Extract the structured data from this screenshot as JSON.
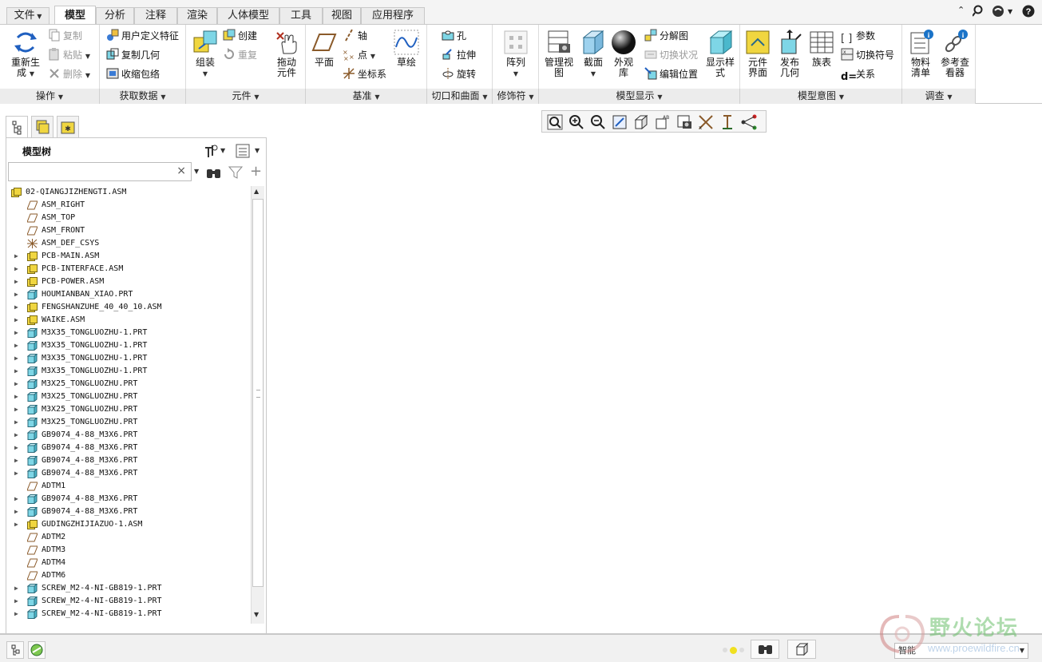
{
  "tabs": [
    "文件",
    "模型",
    "分析",
    "注释",
    "渲染",
    "人体模型",
    "工具",
    "视图",
    "应用程序"
  ],
  "ribbon": {
    "operations": {
      "regen": "重新生成",
      "copy": "复制",
      "paste": "粘贴",
      "delete": "删除",
      "label": "操作"
    },
    "getdata": {
      "udf": "用户定义特征",
      "copygeom": "复制几何",
      "shrinkwrap": "收缩包络",
      "label": "获取数据"
    },
    "component": {
      "assemble": "组装",
      "create": "创建",
      "repeat": "重复",
      "drag": "拖动元件",
      "label": "元件"
    },
    "datum": {
      "plane": "平面",
      "axis": "轴",
      "point": "点",
      "csys": "坐标系",
      "sketch": "草绘",
      "label": "基准"
    },
    "cut": {
      "hole": "孔",
      "extrude": "拉伸",
      "revolve": "旋转",
      "label": "切口和曲面"
    },
    "modifiers": {
      "pattern": "阵列",
      "label": "修饰符"
    },
    "display": {
      "manageview": "管理视图",
      "section": "截面",
      "appearance": "外观库",
      "explode": "分解图",
      "toggle": "切换状况",
      "editpos": "编辑位置",
      "dispstyle": "显示样式",
      "label": "模型显示"
    },
    "intent": {
      "compinterface": "元件界面",
      "pubgeom": "发布几何",
      "family": "族表",
      "params": "参数",
      "switchsym": "切换符号",
      "relations": "关系",
      "label": "模型意图"
    },
    "investigate": {
      "bom": "物料清单",
      "refviewer": "参考查看器",
      "label": "调查"
    }
  },
  "panel": {
    "title": "模型树",
    "search_placeholder": ""
  },
  "tree": [
    {
      "label": "02-QIANGJIZHENGTI.ASM",
      "type": "asm",
      "expandable": false,
      "root": true
    },
    {
      "label": "ASM_RIGHT",
      "type": "datum",
      "expandable": false
    },
    {
      "label": "ASM_TOP",
      "type": "datum",
      "expandable": false
    },
    {
      "label": "ASM_FRONT",
      "type": "datum",
      "expandable": false
    },
    {
      "label": "ASM_DEF_CSYS",
      "type": "csys",
      "expandable": false
    },
    {
      "label": "PCB-MAIN.ASM",
      "type": "asm",
      "expandable": true
    },
    {
      "label": "PCB-INTERFACE.ASM",
      "type": "asm",
      "expandable": true
    },
    {
      "label": "PCB-POWER.ASM",
      "type": "asm",
      "expandable": true
    },
    {
      "label": "HOUMIANBAN_XIAO.PRT",
      "type": "prt",
      "expandable": true
    },
    {
      "label": "FENGSHANZUHE_40_40_10.ASM",
      "type": "asm",
      "expandable": true
    },
    {
      "label": "WAIKE.ASM",
      "type": "asm",
      "expandable": true
    },
    {
      "label": "M3X35_TONGLUOZHU-1.PRT",
      "type": "prt",
      "expandable": true
    },
    {
      "label": "M3X35_TONGLUOZHU-1.PRT",
      "type": "prt",
      "expandable": true
    },
    {
      "label": "M3X35_TONGLUOZHU-1.PRT",
      "type": "prt",
      "expandable": true
    },
    {
      "label": "M3X35_TONGLUOZHU-1.PRT",
      "type": "prt",
      "expandable": true
    },
    {
      "label": "M3X25_TONGLUOZHU.PRT",
      "type": "prt",
      "expandable": true
    },
    {
      "label": "M3X25_TONGLUOZHU.PRT",
      "type": "prt",
      "expandable": true
    },
    {
      "label": "M3X25_TONGLUOZHU.PRT",
      "type": "prt",
      "expandable": true
    },
    {
      "label": "M3X25_TONGLUOZHU.PRT",
      "type": "prt",
      "expandable": true
    },
    {
      "label": "GB9074_4-88_M3X6.PRT",
      "type": "prt",
      "expandable": true
    },
    {
      "label": "GB9074_4-88_M3X6.PRT",
      "type": "prt",
      "expandable": true
    },
    {
      "label": "GB9074_4-88_M3X6.PRT",
      "type": "prt",
      "expandable": true
    },
    {
      "label": "GB9074_4-88_M3X6.PRT",
      "type": "prt",
      "expandable": true
    },
    {
      "label": "ADTM1",
      "type": "datum",
      "expandable": false
    },
    {
      "label": "GB9074_4-88_M3X6.PRT",
      "type": "prt",
      "expandable": true
    },
    {
      "label": "GB9074_4-88_M3X6.PRT",
      "type": "prt",
      "expandable": true
    },
    {
      "label": "GUDINGZHIJIAZUO-1.ASM",
      "type": "asm",
      "expandable": true
    },
    {
      "label": "ADTM2",
      "type": "datum",
      "expandable": false
    },
    {
      "label": "ADTM3",
      "type": "datum",
      "expandable": false
    },
    {
      "label": "ADTM4",
      "type": "datum",
      "expandable": false
    },
    {
      "label": "ADTM6",
      "type": "datum",
      "expandable": false
    },
    {
      "label": "SCREW_M2-4-NI-GB819-1.PRT",
      "type": "prt",
      "expandable": true
    },
    {
      "label": "SCREW_M2-4-NI-GB819-1.PRT",
      "type": "prt",
      "expandable": true
    },
    {
      "label": "SCREW_M2-4-NI-GB819-1.PRT",
      "type": "prt",
      "expandable": true
    }
  ],
  "status": {
    "filter": "智能"
  },
  "watermark": {
    "brand": "野火论坛",
    "url": "www.proewildfire.cn"
  },
  "colors": {
    "asm": "#f0d640",
    "prt": "#7ed6e6",
    "datum": "#8a5a2a",
    "accent": "#1a73c8"
  }
}
